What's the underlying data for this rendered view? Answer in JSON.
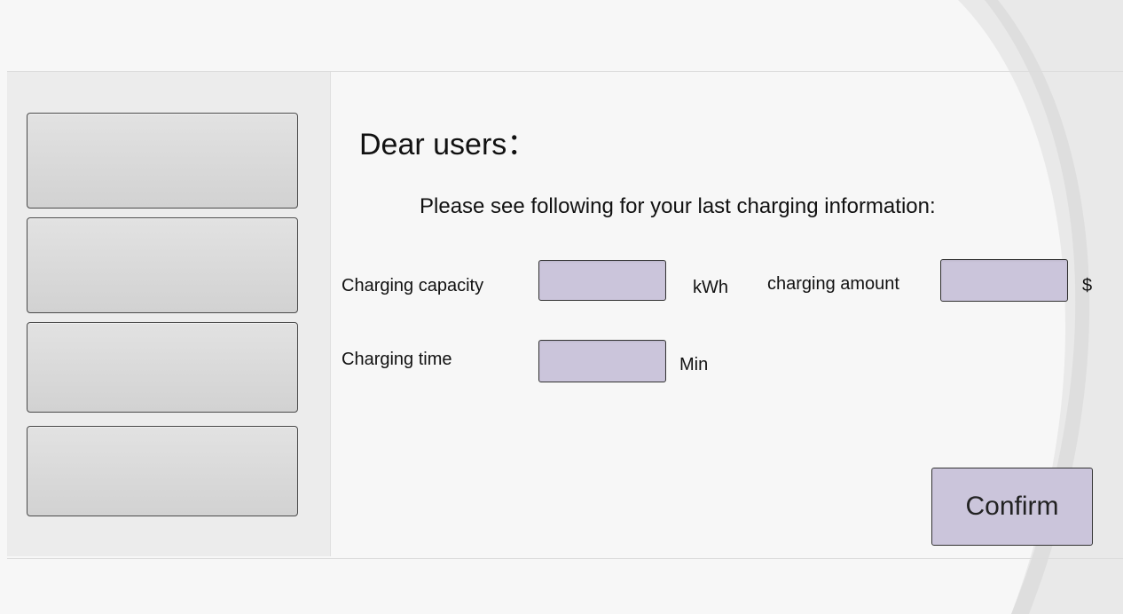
{
  "sidebar": {
    "buttons": [
      {
        "label": ""
      },
      {
        "label": ""
      },
      {
        "label": ""
      },
      {
        "label": ""
      }
    ]
  },
  "main": {
    "greeting": "Dear users：",
    "instruction": "Please see following for your last charging information:",
    "fields": {
      "charging_capacity": {
        "label": "Charging capacity",
        "unit": "kWh",
        "value": ""
      },
      "charging_amount": {
        "label": "charging amount",
        "unit": "$",
        "value": ""
      },
      "charging_time": {
        "label": "Charging time",
        "unit": "Min",
        "value": ""
      }
    },
    "confirm_label": "Confirm"
  },
  "colors": {
    "field_fill": "#cbc5db",
    "panel_bg": "#ececec",
    "page_bg": "#f7f7f7"
  }
}
